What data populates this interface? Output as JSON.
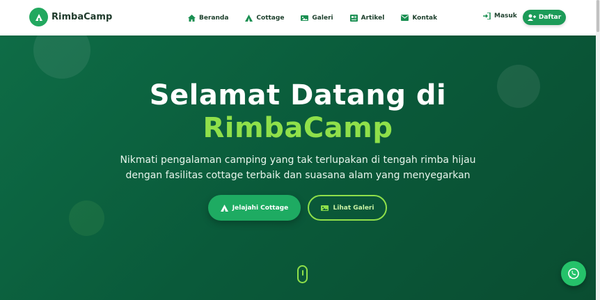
{
  "brand": {
    "name": "RimbaCamp",
    "logo_icon": "tent-icon"
  },
  "nav": {
    "items": [
      {
        "label": "Beranda",
        "icon": "home-icon"
      },
      {
        "label": "Cottage",
        "icon": "tent-icon"
      },
      {
        "label": "Galeri",
        "icon": "gallery-icon"
      },
      {
        "label": "Artikel",
        "icon": "article-icon"
      },
      {
        "label": "Kontak",
        "icon": "mail-icon"
      }
    ],
    "login_label": "Masuk",
    "register_label": "Daftar"
  },
  "hero": {
    "title_line1": "Selamat Datang di",
    "title_line2": "RimbaCamp",
    "subtitle_line1": "Nikmati pengalaman camping yang tak terlupakan di tengah rimba hijau",
    "subtitle_line2": "dengan fasilitas cottage terbaik dan suasana alam yang menyegarkan",
    "primary_button": "Jelajahi Cottage",
    "secondary_button": "Lihat Galeri"
  },
  "colors": {
    "brand_green": "#1c9b58",
    "accent_lime": "#8fe04a",
    "hero_bg": "#0b5a39",
    "whatsapp": "#25c26a"
  }
}
